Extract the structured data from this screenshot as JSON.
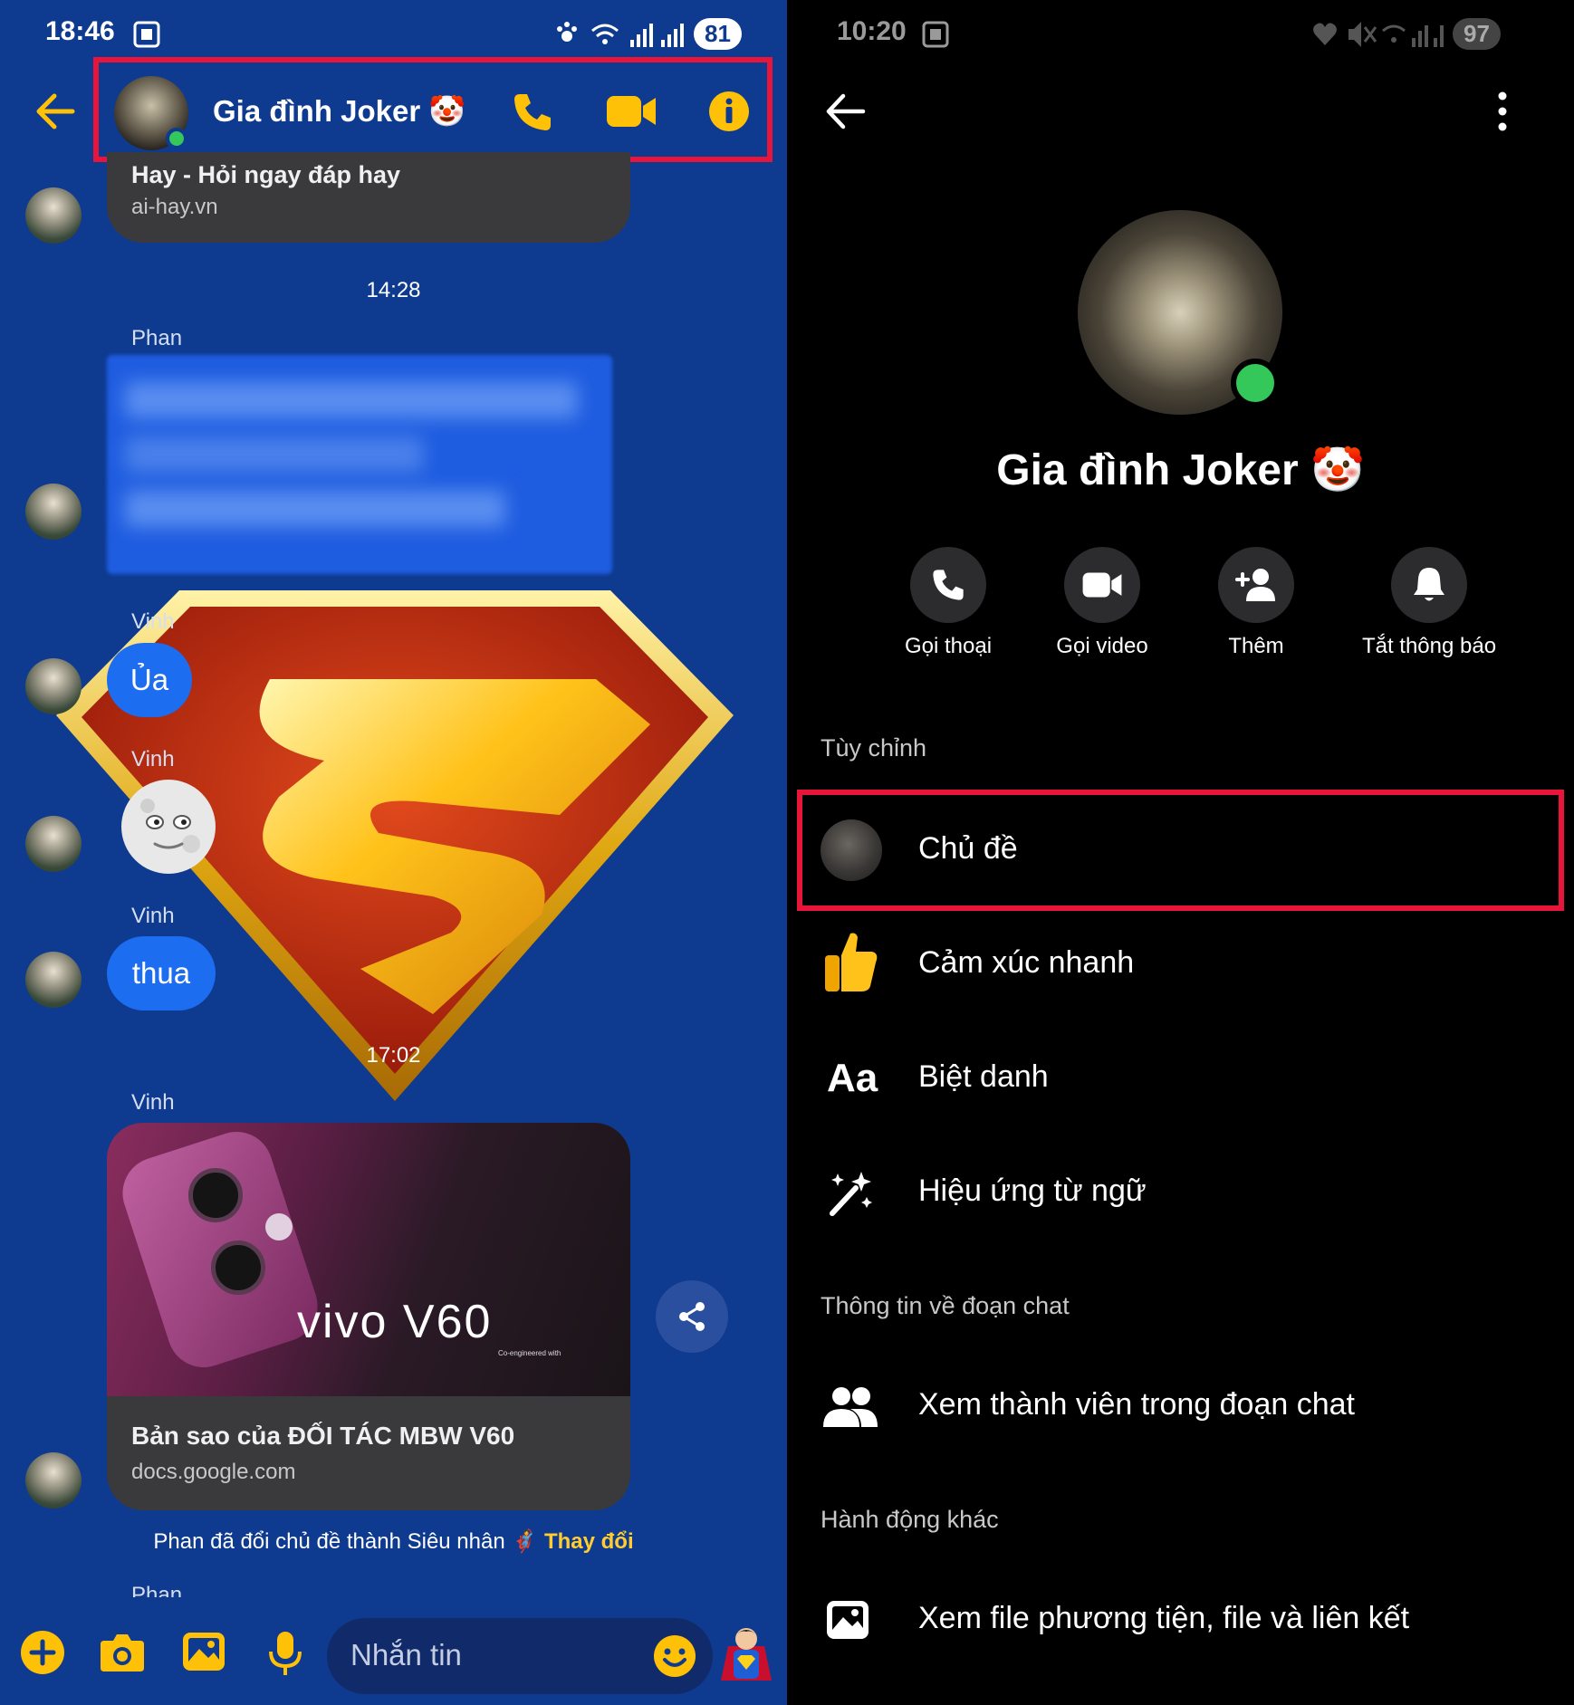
{
  "left": {
    "status_bar": {
      "time": "18:46",
      "battery": "81"
    },
    "header": {
      "title": "Gia đình Joker 🤡"
    },
    "messages": {
      "link_card_top": {
        "title": "Hay - Hỏi ngay đáp hay",
        "domain": "ai-hay.vn"
      },
      "timestamp_1": "14:28",
      "sender_phan": "Phan",
      "sender_vinh_1": "Vinh",
      "bubble_ua": "Ủa",
      "sender_vinh_2": "Vinh",
      "sender_vinh_3": "Vinh",
      "bubble_thua": "thua",
      "timestamp_2": "17:02",
      "sender_vinh_4": "Vinh",
      "vivo_card": {
        "brand_text": "vivo V60",
        "brand_sub": "Co-engineered with",
        "title": "Bản sao của ĐỐI TÁC MBW V60",
        "domain": "docs.google.com"
      },
      "system_notice": "Phan đã đổi chủ đề thành Siêu nhân",
      "system_action": "Thay đổi",
      "sender_phan_2": "Phan"
    },
    "composer": {
      "placeholder": "Nhắn tin"
    }
  },
  "right": {
    "status_bar": {
      "time": "10:20",
      "battery": "97"
    },
    "profile": {
      "name": "Gia đình Joker 🤡"
    },
    "actions": [
      {
        "label": "Gọi thoại",
        "icon": "phone-icon"
      },
      {
        "label": "Gọi video",
        "icon": "video-icon"
      },
      {
        "label": "Thêm",
        "icon": "add-person-icon"
      },
      {
        "label": "Tắt thông báo",
        "icon": "bell-icon"
      }
    ],
    "sections": {
      "customize": "Tùy chỉnh",
      "chat_info": "Thông tin về đoạn chat",
      "other_actions": "Hành động khác"
    },
    "rows": {
      "theme": "Chủ đề",
      "quick_reaction": "Cảm xúc nhanh",
      "nickname_icon_text": "Aa",
      "nickname": "Biệt danh",
      "word_effects": "Hiệu ứng từ ngữ",
      "members": "Xem thành viên trong đoạn chat",
      "media": "Xem file phương tiện, file và liên kết"
    }
  },
  "colors": {
    "chat_bg": "#0e3a8f",
    "accent_yellow": "#ffc107",
    "bubble_blue": "#1d6df0",
    "highlight_red": "#e8153a",
    "online_green": "#34c759"
  }
}
